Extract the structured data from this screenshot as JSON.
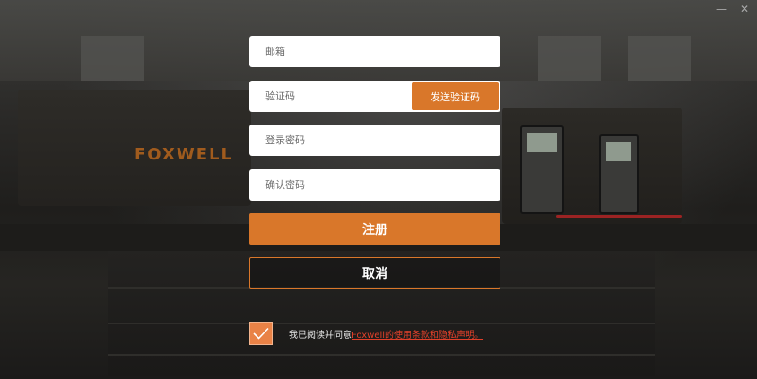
{
  "background": {
    "brand_text": "FOXWELL"
  },
  "window": {
    "minimize_glyph": "—",
    "close_glyph": "✕"
  },
  "form": {
    "email_placeholder": "邮箱",
    "code_placeholder": "验证码",
    "send_code_label": "发送验证码",
    "password_placeholder": "登录密码",
    "confirm_password_placeholder": "确认密码",
    "register_label": "注册",
    "cancel_label": "取消"
  },
  "agreement": {
    "checked": true,
    "text": "我已阅读并同意 ",
    "link_text": "Foxwell的使用条款和隐私声明。"
  },
  "colors": {
    "accent": "#d9772a",
    "checkbox": "#e98246",
    "link": "#e0402a"
  }
}
